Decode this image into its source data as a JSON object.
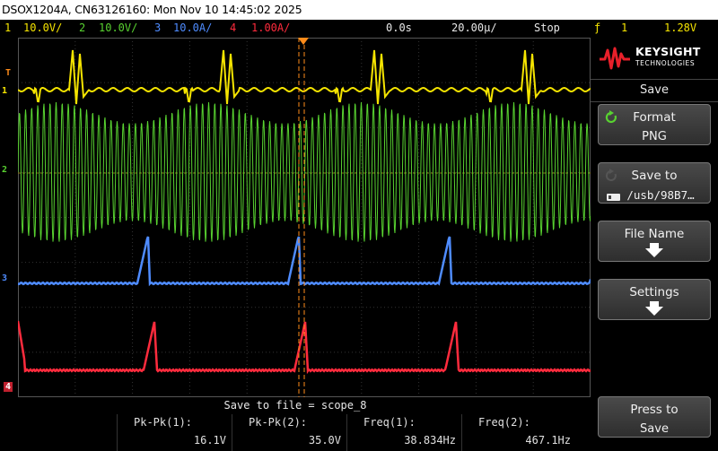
{
  "title": "DSOX1204A, CN63126160: Mon Nov 10 14:45:02 2025",
  "status": {
    "ch1_num": "1",
    "ch1_scale": "10.0V/",
    "ch2_num": "2",
    "ch2_scale": "10.0V/",
    "ch3_num": "3",
    "ch3_scale": "10.0A/",
    "ch4_num": "4",
    "ch4_scale": "1.00A/",
    "time_delay": "0.0s",
    "time_scale": "20.00µ/",
    "run_state": "Stop",
    "trigger_source": "1",
    "trigger_level": "1.28V"
  },
  "markers": {
    "trigger": "T",
    "ch1": "1",
    "ch2": "2",
    "ch3": "3",
    "ch4": "4"
  },
  "save_to_file": "Save to file = scope_8",
  "measurements": [
    {
      "label": "Pk-Pk(1):",
      "value": "16.1V",
      "color": "#f5e400"
    },
    {
      "label": "Pk-Pk(2):",
      "value": "35.0V",
      "color": "#58d230"
    },
    {
      "label": "Freq(1):",
      "value": "38.834Hz",
      "color": "#f5e400"
    },
    {
      "label": "Freq(2):",
      "value": "467.1Hz",
      "color": "#58d230"
    }
  ],
  "sidebar": {
    "brand": "KEYSIGHT",
    "brand_sub": "TECHNOLOGIES",
    "menu_title": "Save",
    "format_label": "Format",
    "format_value": "PNG",
    "save_to_label": "Save to",
    "save_to_value": "/usb/98B7…",
    "file_name_label": "File Name",
    "settings_label": "Settings",
    "press_to_save_1": "Press to",
    "press_to_save_2": "Save"
  },
  "colors": {
    "ch1": "#f5e400",
    "ch2": "#58d230",
    "ch3": "#4f8cff",
    "ch4": "#ff2b3d",
    "trigger": "#ff8c1a"
  }
}
